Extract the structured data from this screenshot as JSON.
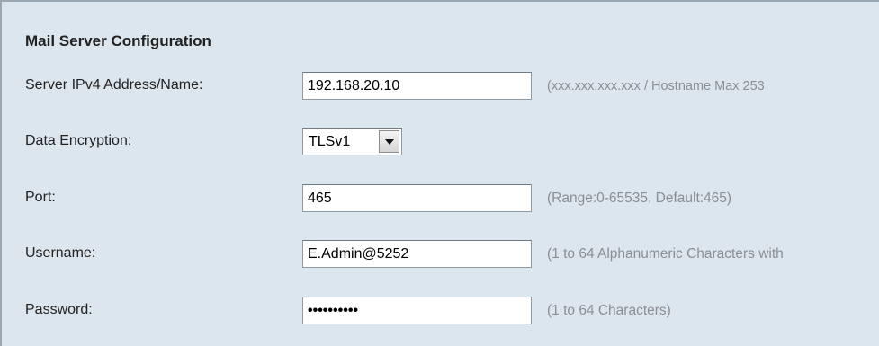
{
  "section": {
    "title": "Mail Server Configuration"
  },
  "fields": {
    "server": {
      "label": "Server IPv4 Address/Name:",
      "value": "192.168.20.10",
      "hint": "(xxx.xxx.xxx.xxx / Hostname Max 253"
    },
    "encryption": {
      "label": "Data Encryption:",
      "value": "TLSv1"
    },
    "port": {
      "label": "Port:",
      "value": "465",
      "hint": "(Range:0-65535, Default:465)"
    },
    "username": {
      "label": "Username:",
      "value": "E.Admin@5252",
      "hint": "(1 to 64 Alphanumeric Characters with"
    },
    "password": {
      "label": "Password:",
      "value": "••••••••••",
      "hint": "(1 to 64 Characters)"
    }
  },
  "icons": {
    "dropdown": "chevron-down-icon"
  }
}
